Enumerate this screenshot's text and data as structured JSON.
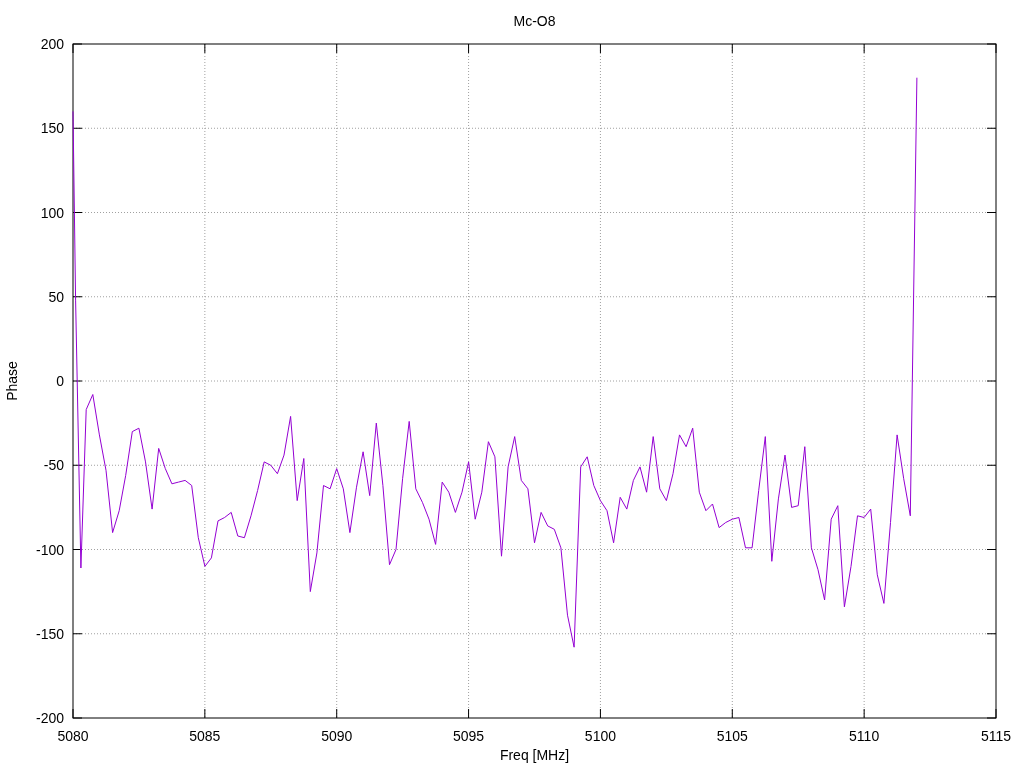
{
  "chart_data": {
    "type": "line",
    "title": "Mc-O8",
    "xlabel": "Freq [MHz]",
    "ylabel": "Phase",
    "xlim": [
      5080,
      5115
    ],
    "ylim": [
      -200,
      200
    ],
    "xticks": [
      5080,
      5085,
      5090,
      5095,
      5100,
      5105,
      5110,
      5115
    ],
    "yticks": [
      -200,
      -150,
      -100,
      -50,
      0,
      50,
      100,
      150,
      200
    ],
    "x": [
      5080,
      5080.1,
      5080.3,
      5080.5,
      5080.75,
      5081,
      5081.25,
      5081.5,
      5081.75,
      5082,
      5082.25,
      5082.5,
      5082.75,
      5083,
      5083.25,
      5083.5,
      5083.75,
      5084,
      5084.25,
      5084.5,
      5084.75,
      5085,
      5085.25,
      5085.5,
      5085.75,
      5086,
      5086.25,
      5086.5,
      5086.75,
      5087,
      5087.25,
      5087.5,
      5087.75,
      5088,
      5088.25,
      5088.5,
      5088.75,
      5089,
      5089.25,
      5089.5,
      5089.75,
      5090,
      5090.25,
      5090.5,
      5090.75,
      5091,
      5091.25,
      5091.5,
      5091.75,
      5092,
      5092.25,
      5092.5,
      5092.75,
      5093,
      5093.25,
      5093.5,
      5093.75,
      5094,
      5094.25,
      5094.5,
      5094.75,
      5095,
      5095.25,
      5095.5,
      5095.75,
      5096,
      5096.25,
      5096.5,
      5096.75,
      5097,
      5097.25,
      5097.5,
      5097.75,
      5098,
      5098.25,
      5098.5,
      5098.75,
      5099,
      5099.25,
      5099.5,
      5099.75,
      5100,
      5100.25,
      5100.5,
      5100.75,
      5101,
      5101.25,
      5101.5,
      5101.75,
      5102,
      5102.25,
      5102.5,
      5102.75,
      5103,
      5103.25,
      5103.5,
      5103.75,
      5104,
      5104.25,
      5104.5,
      5104.75,
      5105,
      5105.25,
      5105.5,
      5105.75,
      5106,
      5106.25,
      5106.5,
      5106.75,
      5107,
      5107.25,
      5107.5,
      5107.75,
      5108,
      5108.25,
      5108.5,
      5108.75,
      5109,
      5109.25,
      5109.5,
      5109.75,
      5110,
      5110.25,
      5110.5,
      5110.75,
      5111,
      5111.25,
      5111.5,
      5111.75,
      5112
    ],
    "grid": true,
    "series": [
      {
        "color": "#9400d3",
        "values": [
          160,
          48,
          -111,
          -17,
          -8,
          -32,
          -53,
          -90,
          -77,
          -56,
          -30,
          -28,
          -48,
          -76,
          -40,
          -52,
          -61,
          -60,
          -59,
          -62,
          -93,
          -110,
          -105,
          -83,
          -81,
          -78,
          -92,
          -93,
          -80,
          -65,
          -48,
          -50,
          -55,
          -44,
          -21,
          -71,
          -46,
          -125,
          -102,
          -62,
          -64,
          -52,
          -64,
          -90,
          -63,
          -42,
          -68,
          -25,
          -62,
          -109,
          -100,
          -58,
          -24,
          -64,
          -72,
          -82,
          -97,
          -60,
          -66,
          -78,
          -66,
          -48,
          -82,
          -66,
          -36,
          -45,
          -104,
          -51,
          -33,
          -59,
          -64,
          -96,
          -78,
          -86,
          -88,
          -99,
          -139,
          -158,
          -51,
          -45,
          -62,
          -71,
          -77,
          -96,
          -69,
          -76,
          -59,
          -51,
          -66,
          -33,
          -64,
          -71,
          -55,
          -32,
          -39,
          -28,
          -66,
          -77,
          -73,
          -87,
          -84,
          -82,
          -81,
          -99,
          -99,
          -65,
          -33,
          -107,
          -70,
          -44,
          -75,
          -74,
          -39,
          -99,
          -112,
          -130,
          -82,
          -74,
          -134,
          -110,
          -80,
          -81,
          -76,
          -115,
          -132,
          -84,
          -32,
          -58,
          -80,
          180
        ]
      }
    ]
  }
}
